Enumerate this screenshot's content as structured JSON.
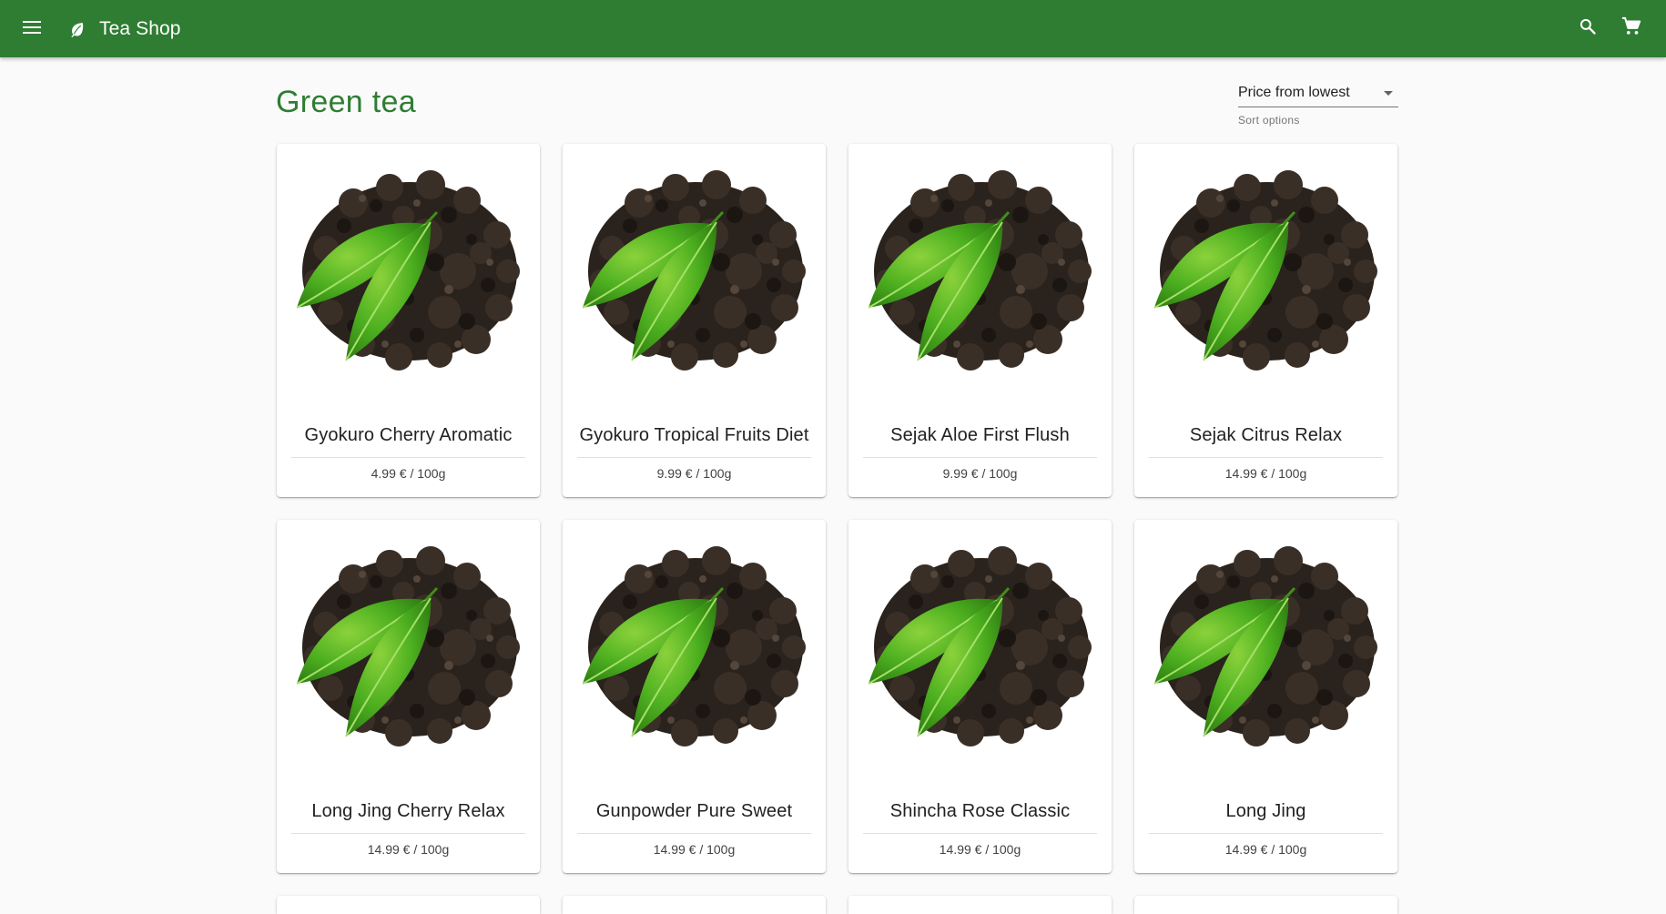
{
  "app_bar": {
    "title": "Tea Shop",
    "menu_icon": "menu-icon",
    "brand_icon": "leaf-icon",
    "search_icon": "search-icon",
    "cart_icon": "cart-icon",
    "bar_color": "#2e7d32"
  },
  "page": {
    "title": "Green tea"
  },
  "sort": {
    "value": "Price from lowest",
    "helper": "Sort options"
  },
  "products": [
    {
      "name": "Gyokuro Cherry Aromatic",
      "price": "4.99 € / 100g"
    },
    {
      "name": "Gyokuro Tropical Fruits Diet",
      "price": "9.99 € / 100g"
    },
    {
      "name": "Sejak Aloe First Flush",
      "price": "9.99 € / 100g"
    },
    {
      "name": "Sejak Citrus Relax",
      "price": "14.99 € / 100g"
    },
    {
      "name": "Long Jing Cherry Relax",
      "price": "14.99 € / 100g"
    },
    {
      "name": "Gunpowder Pure Sweet",
      "price": "14.99 € / 100g"
    },
    {
      "name": "Shincha Rose Classic",
      "price": "14.99 € / 100g"
    },
    {
      "name": "Long Jing",
      "price": "14.99 € / 100g"
    }
  ]
}
